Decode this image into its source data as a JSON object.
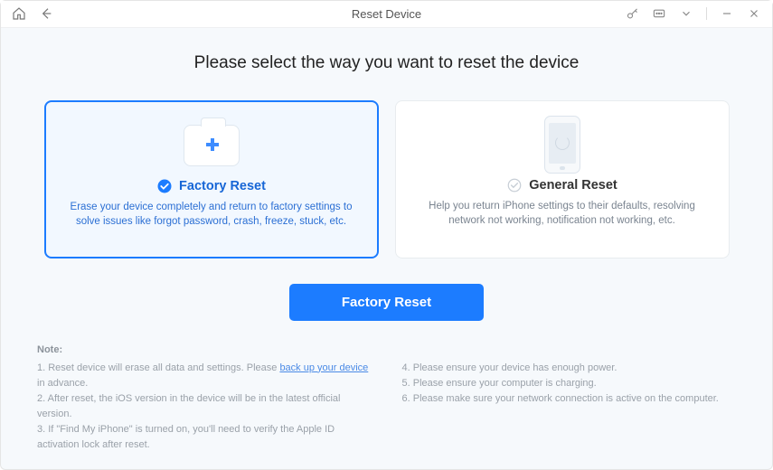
{
  "titlebar": {
    "title": "Reset Device"
  },
  "headline": "Please select the way you want to reset the device",
  "cards": {
    "factory": {
      "title": "Factory Reset",
      "desc": "Erase your device completely and return to factory settings to solve issues like forgot password, crash, freeze, stuck, etc."
    },
    "general": {
      "title": "General Reset",
      "desc": "Help you return iPhone settings to their defaults, resolving network not working, notification not working, etc."
    }
  },
  "action": {
    "primary_label": "Factory Reset"
  },
  "notes": {
    "title": "Note:",
    "left": {
      "n1a": "1. Reset device will erase all data and settings. Please ",
      "n1_link": "back up your device",
      "n1b": " in advance.",
      "n2": "2. After reset, the iOS version in the device will be in the latest official version.",
      "n3": "3. If \"Find My iPhone\" is turned on, you'll need to verify the Apple ID activation lock after reset."
    },
    "right": {
      "n4": "4. Please ensure your device has enough power.",
      "n5": "5. Please ensure your computer is charging.",
      "n6": "6. Please make sure your network connection is active on the computer."
    }
  }
}
